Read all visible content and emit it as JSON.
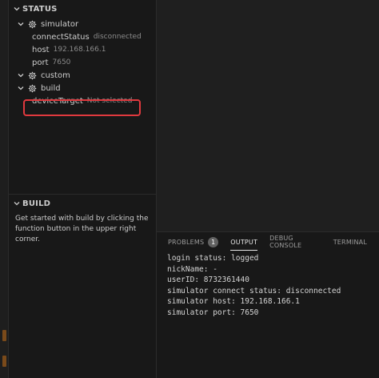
{
  "status_section": {
    "title": "STATUS",
    "groups": {
      "simulator": {
        "label": "simulator",
        "items": [
          {
            "key": "connectStatus",
            "value": "disconnected"
          },
          {
            "key": "host",
            "value": "192.168.166.1"
          },
          {
            "key": "port",
            "value": "7650"
          }
        ]
      },
      "custom": {
        "label": "custom"
      },
      "build": {
        "label": "build",
        "items": [
          {
            "key": "deviceTarget",
            "value": "Not selected"
          }
        ]
      }
    }
  },
  "build_section": {
    "title": "BUILD",
    "description": "Get started with build by clicking the function button in the upper right corner."
  },
  "panel": {
    "tabs": [
      {
        "label": "PROBLEMS",
        "badge": "1"
      },
      {
        "label": "OUTPUT"
      },
      {
        "label": "DEBUG CONSOLE"
      },
      {
        "label": "TERMINAL"
      }
    ],
    "active_tab": "OUTPUT",
    "output_lines": [
      "login status: logged",
      "nickName: -",
      "userID: 8732361440",
      "simulator connect status: disconnected",
      "simulator host: 192.168.166.1",
      "simulator port: 7650"
    ]
  },
  "colors": {
    "highlight": "#e0393e",
    "background": "#181818"
  }
}
